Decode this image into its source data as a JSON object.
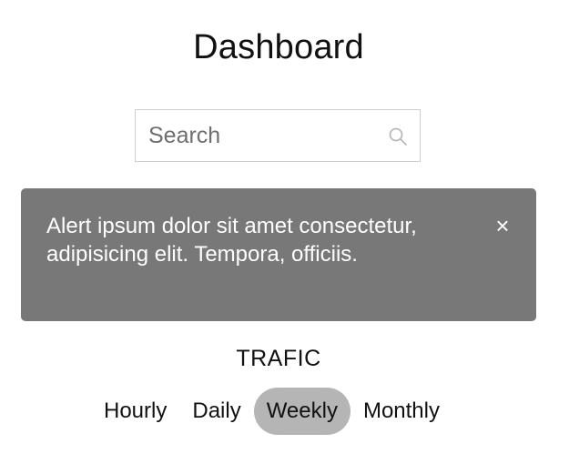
{
  "header": {
    "title": "Dashboard"
  },
  "search": {
    "placeholder": "Search",
    "value": "",
    "icon": "search-icon"
  },
  "alert": {
    "message": "Alert ipsum dolor sit amet consectetur, adipisicing elit. Tempora, officiis.",
    "close_symbol": "×",
    "background_color": "#787878"
  },
  "traffic": {
    "label": "TRAFIC",
    "tabs": [
      {
        "label": "Hourly",
        "active": false
      },
      {
        "label": "Daily",
        "active": false
      },
      {
        "label": "Weekly",
        "active": true
      },
      {
        "label": "Monthly",
        "active": false
      }
    ],
    "active_tab_color": "#b5b5b5"
  }
}
